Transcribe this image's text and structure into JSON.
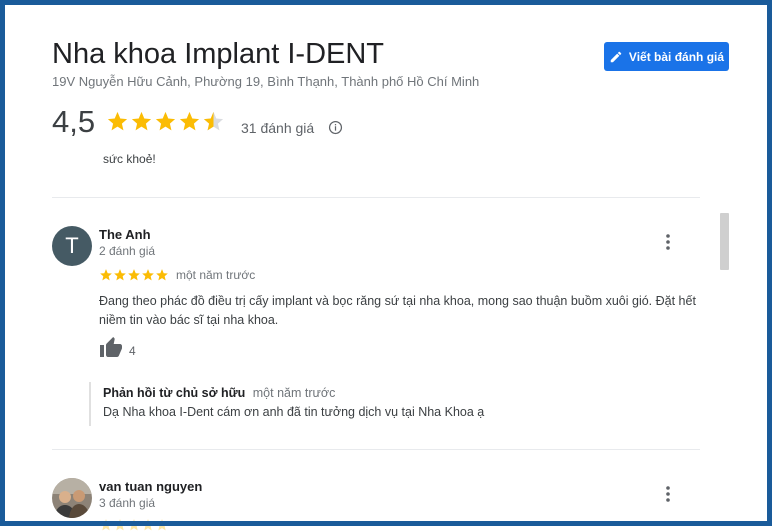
{
  "place": {
    "name": "Nha khoa Implant I-DENT",
    "address": "19V Nguyễn Hữu Cảnh, Phường 19, Bình Thạnh, Thành phố Hồ Chí Minh",
    "write_review_label": "Viết bài đánh giá",
    "rating": "4,5",
    "rating_value": 4.5,
    "review_count_label": "31 đánh giá"
  },
  "previous_review_tail": "sức khoẻ!",
  "reviews": [
    {
      "avatar_letter": "T",
      "author": "The Anh",
      "author_meta": "2 đánh giá",
      "stars": 5,
      "time": "một năm trước",
      "text": "Đang theo phác đồ điều trị cấy implant và bọc răng sứ tại nha khoa, mong sao thuận buồm xuôi gió. Đặt hết niềm tin vào bác sĩ tại nha khoa.",
      "likes": "4",
      "owner_reply": {
        "label": "Phản hồi từ chủ sở hữu",
        "time": "một năm trước",
        "text": "Dạ Nha khoa I-Dent cám ơn anh đã tin tưởng dịch vụ tại Nha Khoa ạ"
      }
    },
    {
      "author": "van tuan nguyen",
      "author_meta": "3 đánh giá"
    }
  ],
  "colors": {
    "star": "#fbbc04",
    "button": "#1a73e8",
    "frame": "#1a5b9a",
    "avatar_bg": "#455a64"
  },
  "icons": [
    "pencil-icon",
    "star-icon",
    "info-icon",
    "more-vert-icon",
    "thumb-up-icon"
  ]
}
